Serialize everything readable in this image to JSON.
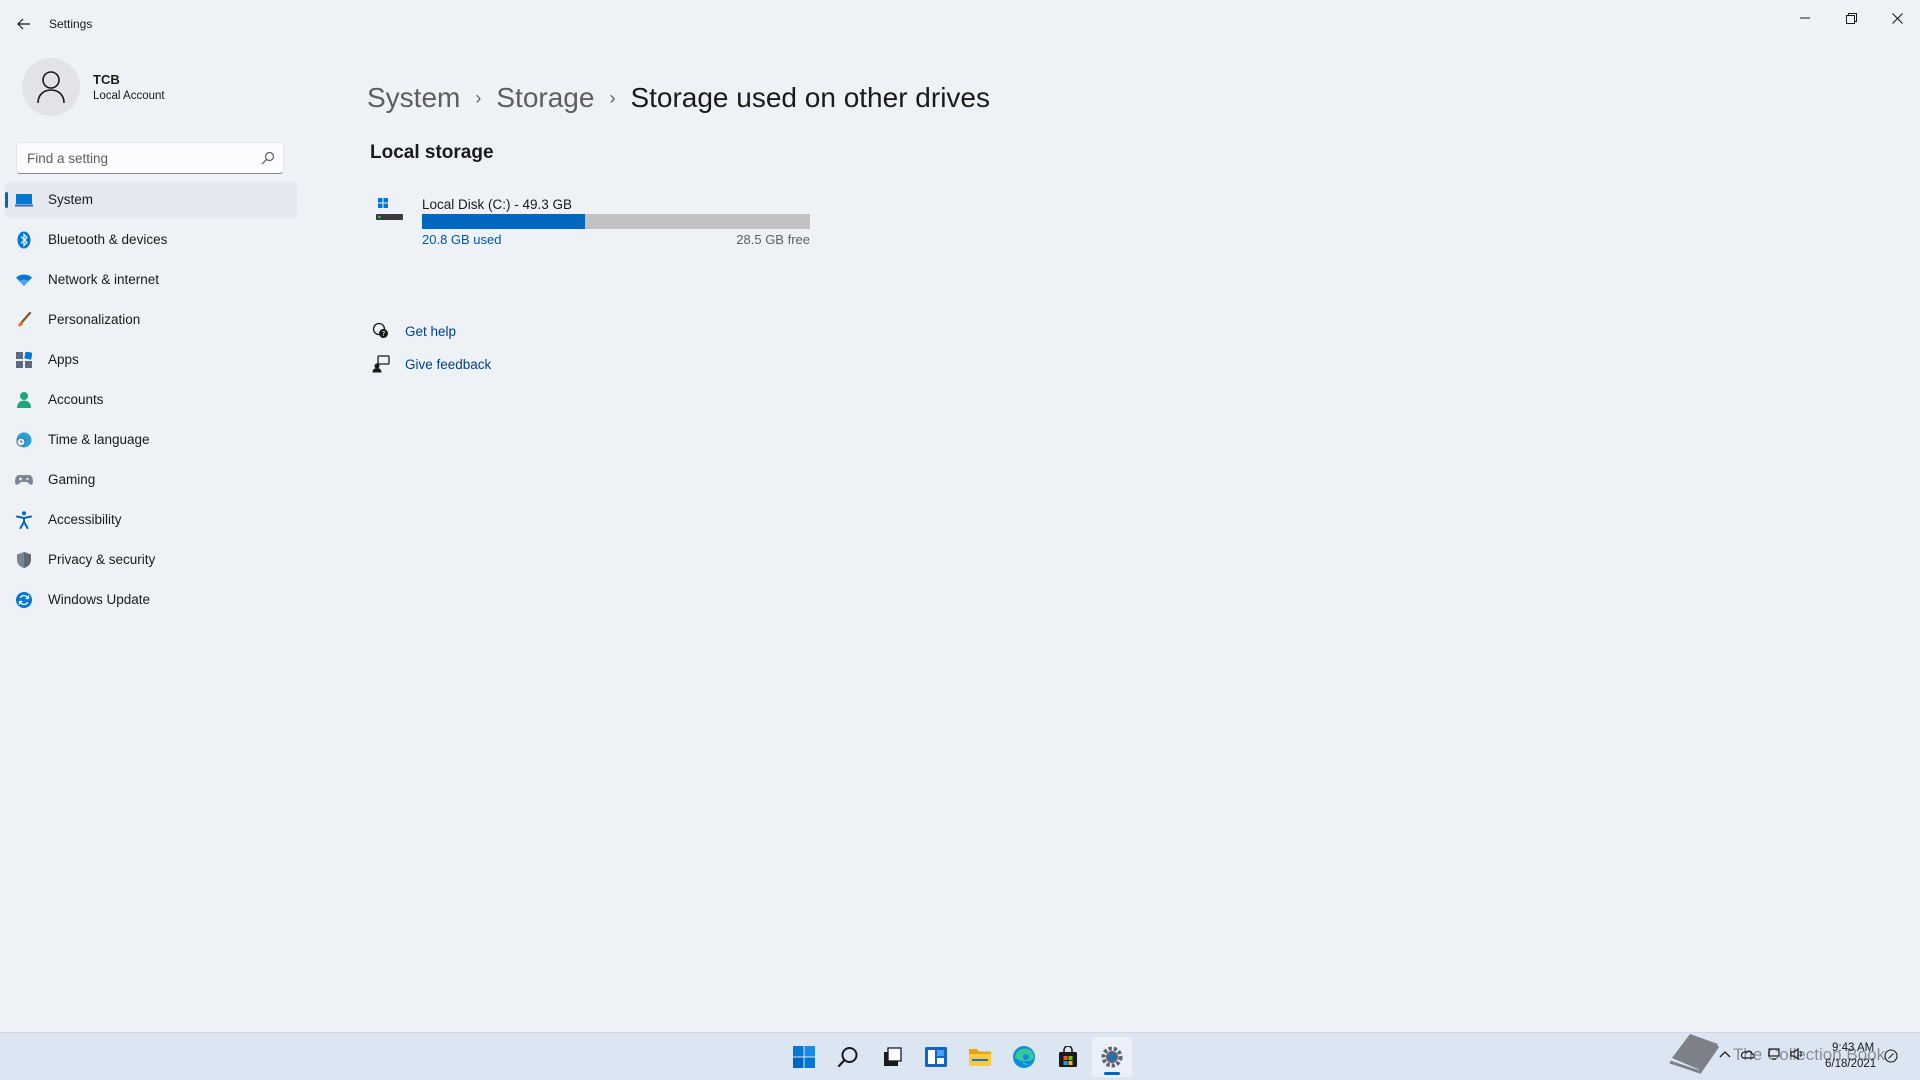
{
  "window": {
    "title": "Settings",
    "controls": {
      "minimize": "minimize-icon",
      "maximize": "restore-icon",
      "close": "close-icon"
    }
  },
  "account": {
    "name": "TCB",
    "type": "Local Account"
  },
  "search": {
    "placeholder": "Find a setting"
  },
  "sidebar": {
    "items": [
      {
        "label": "System",
        "icon": "laptop-icon",
        "selected": true
      },
      {
        "label": "Bluetooth & devices",
        "icon": "bluetooth-icon"
      },
      {
        "label": "Network & internet",
        "icon": "wifi-icon"
      },
      {
        "label": "Personalization",
        "icon": "brush-icon"
      },
      {
        "label": "Apps",
        "icon": "apps-icon"
      },
      {
        "label": "Accounts",
        "icon": "person-icon"
      },
      {
        "label": "Time & language",
        "icon": "globe-clock-icon"
      },
      {
        "label": "Gaming",
        "icon": "controller-icon"
      },
      {
        "label": "Accessibility",
        "icon": "accessibility-icon"
      },
      {
        "label": "Privacy & security",
        "icon": "shield-icon"
      },
      {
        "label": "Windows Update",
        "icon": "update-icon"
      }
    ]
  },
  "breadcrumb": {
    "items": [
      "System",
      "Storage",
      "Storage used on other drives"
    ],
    "separator": "›"
  },
  "main": {
    "section_title": "Local storage",
    "drive": {
      "name": "Local Disk (C:) - 49.3 GB",
      "used": "20.8 GB used",
      "free": "28.5 GB free",
      "used_fraction": 0.42
    },
    "help": {
      "get_help": "Get help",
      "give_feedback": "Give feedback"
    }
  },
  "taskbar": {
    "apps": [
      "start-icon",
      "search-icon",
      "task-view-icon",
      "widgets-icon",
      "file-explorer-icon",
      "edge-icon",
      "store-icon",
      "settings-icon"
    ],
    "active": "settings-icon",
    "tray": {
      "time": "9:43 AM",
      "date": "6/18/2021",
      "watermark": "The Collection Book"
    }
  },
  "colors": {
    "accent": "#0067c0",
    "background": "#eef2f7",
    "taskbar": "#dce6f3",
    "link": "#003e92"
  }
}
